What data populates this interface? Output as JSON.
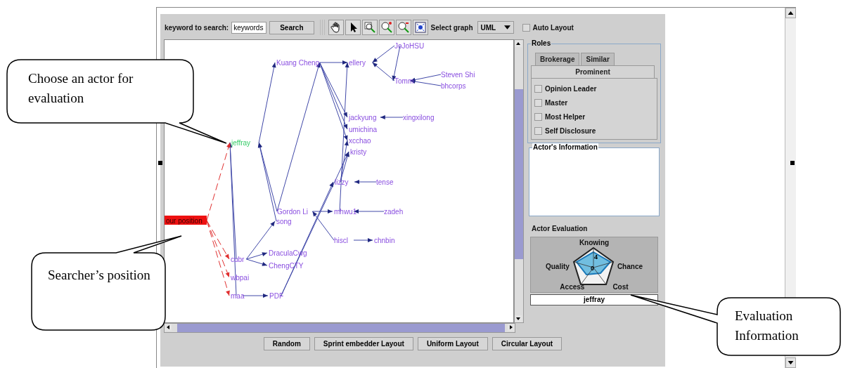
{
  "toolbar": {
    "search_label": "keyword to search:",
    "search_value": "keywords",
    "search_button": "Search",
    "select_label": "Select graph",
    "graph_type": "UML",
    "auto_layout": {
      "label": "Auto Layout",
      "checked": false
    }
  },
  "graph": {
    "nodes": [
      {
        "label": "Kuang Cheng",
        "kind": "actor"
      },
      {
        "label": "ellery",
        "kind": "actor"
      },
      {
        "label": "JoJoHSU",
        "kind": "actor"
      },
      {
        "label": "Tomm",
        "kind": "actor"
      },
      {
        "label": "Steven Shi",
        "kind": "actor"
      },
      {
        "label": "bhcorps",
        "kind": "actor"
      },
      {
        "label": "jackyung",
        "kind": "actor"
      },
      {
        "label": "xingxilong",
        "kind": "actor"
      },
      {
        "label": "umichina",
        "kind": "actor"
      },
      {
        "label": "xcchao",
        "kind": "actor"
      },
      {
        "label": "kristy",
        "kind": "actor"
      },
      {
        "label": "jeffray",
        "kind": "chosen"
      },
      {
        "label": "lizzy",
        "kind": "actor"
      },
      {
        "label": "tense",
        "kind": "actor"
      },
      {
        "label": "Gordon Li",
        "kind": "actor"
      },
      {
        "label": "song",
        "kind": "actor"
      },
      {
        "label": "mhwu1",
        "kind": "actor"
      },
      {
        "label": "zadeh",
        "kind": "actor"
      },
      {
        "label": "hiscl",
        "kind": "actor"
      },
      {
        "label": "chnbin",
        "kind": "actor"
      },
      {
        "label": "our position",
        "kind": "searcher"
      },
      {
        "label": "cubr",
        "kind": "actor"
      },
      {
        "label": "DraculaCwg",
        "kind": "actor"
      },
      {
        "label": "ChengCTY",
        "kind": "actor"
      },
      {
        "label": "wbpai",
        "kind": "actor"
      },
      {
        "label": "maa",
        "kind": "actor"
      },
      {
        "label": "PDF",
        "kind": "actor"
      }
    ]
  },
  "roles": {
    "title": "Roles",
    "tabs": [
      {
        "label": "Brokerage",
        "selected": false
      },
      {
        "label": "Similar",
        "selected": false
      },
      {
        "label": "Prominent",
        "selected": true
      }
    ],
    "options": [
      {
        "label": "Opinion Leader",
        "checked": false
      },
      {
        "label": "Master",
        "checked": false
      },
      {
        "label": "Most Helper",
        "checked": false
      },
      {
        "label": "Self Disclosure",
        "checked": false
      }
    ]
  },
  "actor_information": {
    "title": "Actor's Information"
  },
  "actor_evaluation": {
    "title": "Actor Evaluation",
    "axes": [
      "Knowing",
      "Chance",
      "Cost",
      "Access",
      "Quality"
    ],
    "scale_labels": [
      "4",
      "0"
    ],
    "actor": "jeffray"
  },
  "layout_buttons": [
    "Random",
    "Sprint embedder Layout",
    "Uniform Layout",
    "Circular Layout"
  ],
  "callouts": [
    "Choose an actor for evaluation",
    "Searcher’s position",
    "Evaluation Information"
  ]
}
